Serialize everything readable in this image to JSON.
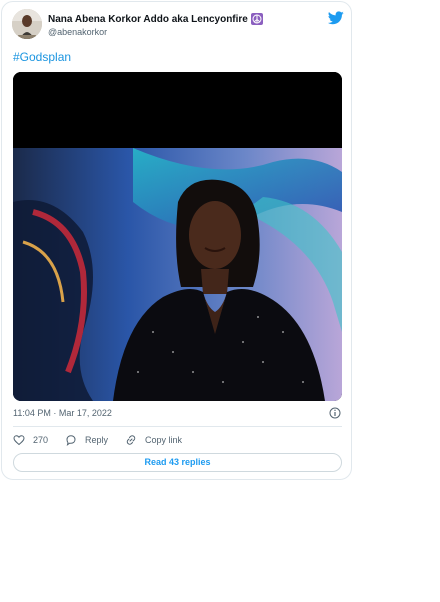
{
  "tweet": {
    "author": {
      "name": "Nana Abena Korkor Addo aka Lencyonfire",
      "name_emoji_icon": "peace-symbol-icon",
      "handle": "@abenakorkor"
    },
    "brand_icon": "twitter-bird-icon",
    "text": "#Godsplan",
    "media_description_icon": "photo",
    "timestamp": "11:04 PM · Mar 17, 2022",
    "actions": {
      "like_count": "270",
      "reply_label": "Reply",
      "copy_link_label": "Copy link"
    },
    "read_replies_label": "Read 43 replies"
  },
  "colors": {
    "link_blue": "#1b95e0",
    "twitter_blue": "#1d9bf0",
    "muted_text": "#536471",
    "border": "#e1e8ed",
    "peace_purple": "#8b5fbf"
  }
}
